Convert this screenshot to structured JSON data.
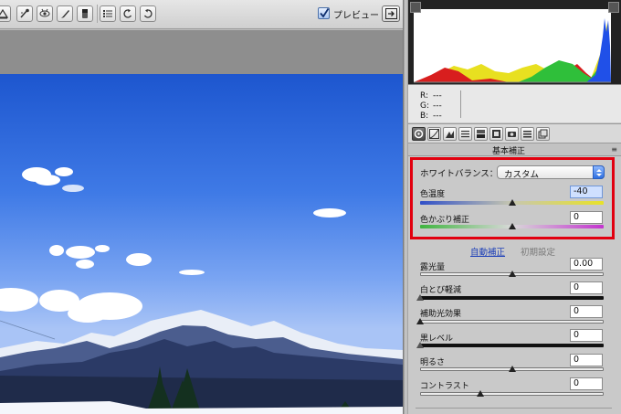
{
  "toolbar": {
    "preview_label": "プレビュー",
    "preview_checked": true,
    "tools": [
      "straighten-icon",
      "spot-removal-icon",
      "red-eye-icon",
      "adjustment-brush-icon",
      "graduated-filter-icon",
      "list-icon",
      "rotate-ccw-icon",
      "rotate-cw-icon"
    ]
  },
  "readout": {
    "r_label": "R:",
    "g_label": "G:",
    "b_label": "B:",
    "r_value": "---",
    "g_value": "---",
    "b_value": "---"
  },
  "panel": {
    "section_title": "基本補正",
    "section_menu_icon": "≡",
    "white_balance_label": "ホワイトバランス：",
    "white_balance_value": "カスタム",
    "auto_label": "自動補正",
    "default_label": "初期設定",
    "sliders": [
      {
        "label": "色温度",
        "value": "-40",
        "fraction": 0.5
      },
      {
        "label": "色かぶり補正",
        "value": "0",
        "fraction": 0.5
      },
      {
        "label": "露光量",
        "value": "0.00",
        "fraction": 0.5
      },
      {
        "label": "白とび軽減",
        "value": "0",
        "fraction": 0.0
      },
      {
        "label": "補助光効果",
        "value": "0",
        "fraction": 0.0
      },
      {
        "label": "黒レベル",
        "value": "0",
        "fraction": 0.0
      },
      {
        "label": "明るさ",
        "value": "0",
        "fraction": 0.5
      },
      {
        "label": "コントラスト",
        "value": "0",
        "fraction": 0.33
      }
    ]
  },
  "colors": {
    "highlight_box": "#e2000f",
    "accent": "#2e6fe0",
    "sky": "#3f7ae6"
  }
}
